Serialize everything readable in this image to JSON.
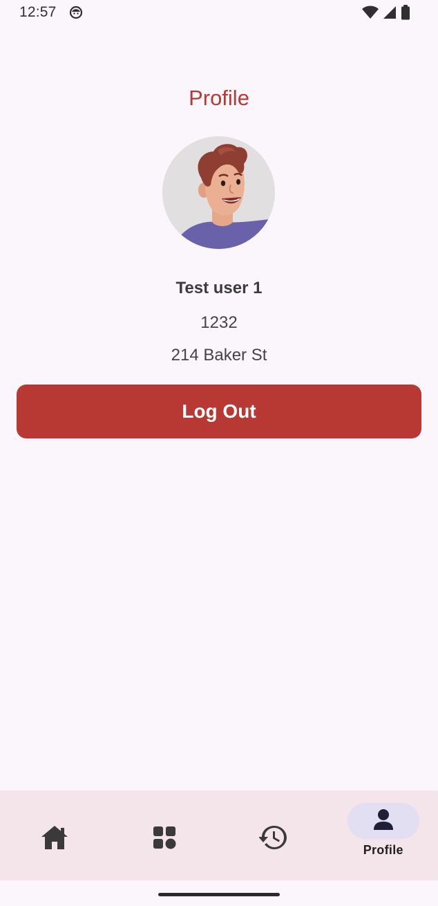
{
  "status_bar": {
    "time": "12:57",
    "icons": [
      "notification-face-icon",
      "wifi-icon",
      "signal-icon",
      "battery-icon"
    ]
  },
  "page": {
    "title": "Profile"
  },
  "user": {
    "name": "Test user 1",
    "id": "1232",
    "address": "214 Baker St"
  },
  "actions": {
    "logout_label": "Log Out"
  },
  "bottom_nav": {
    "items": [
      {
        "key": "home",
        "icon": "home-icon",
        "label": ""
      },
      {
        "key": "categories",
        "icon": "grid-icon",
        "label": ""
      },
      {
        "key": "history",
        "icon": "history-icon",
        "label": ""
      },
      {
        "key": "profile",
        "icon": "person-icon",
        "label": "Profile",
        "active": true
      }
    ]
  },
  "colors": {
    "accent": "#b83833",
    "background": "#fbf6fb",
    "nav_background": "#f3e5ea",
    "active_pill": "#e3dff2"
  }
}
